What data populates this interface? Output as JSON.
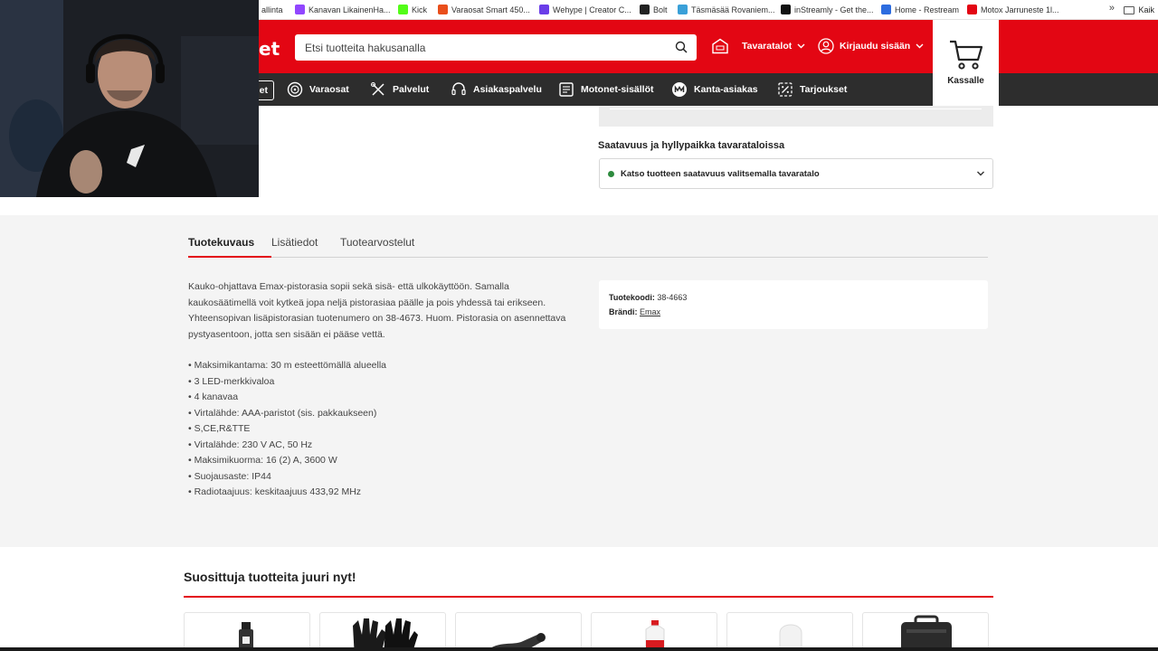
{
  "bookmarks": [
    {
      "label": "allinta",
      "color": "#777777"
    },
    {
      "label": "Kanavan LikainenHa...",
      "color": "#9146ff"
    },
    {
      "label": "Kick",
      "color": "#53fc18"
    },
    {
      "label": "Varaosat Smart 450...",
      "color": "#e94e1b"
    },
    {
      "label": "Wehype | Creator C...",
      "color": "#6a3de8"
    },
    {
      "label": "Bolt",
      "color": "#222222"
    },
    {
      "label": "Täsmäsää Rovaniem...",
      "color": "#3aa0d8"
    },
    {
      "label": "inStreamly - Get the...",
      "color": "#111111"
    },
    {
      "label": "Home - Restream",
      "color": "#2d6cdf"
    },
    {
      "label": "Motox Jarruneste 1l...",
      "color": "#e30613"
    }
  ],
  "bookmarks_more": "»",
  "bookmarks_folder": "Kaik",
  "header": {
    "logo_fragment": "et",
    "search_placeholder": "Etsi tuotteita hakusanalla",
    "stores_label": "Tavaratalot",
    "login_label": "Kirjaudu sisään",
    "cart_label": "Kassalle"
  },
  "nav": {
    "outlined_fragment": "et",
    "items": [
      "Varaosat",
      "Palvelut",
      "Asiakaspalvelu",
      "Motonet-sisällöt",
      "Kanta-asiakas",
      "Tarjoukset"
    ]
  },
  "availability": {
    "title": "Saatavuus ja hyllypaikka tavarataloissa",
    "prompt": "Katso tuotteen saatavuus valitsemalla tavaratalo",
    "status_color": "#2e8b3e"
  },
  "tabs": [
    "Tuotekuvaus",
    "Lisätiedot",
    "Tuotearvostelut"
  ],
  "description": {
    "paragraph": "Kauko-ohjattava Emax-pistorasia sopii sekä sisä- että ulkokäyttöön. Samalla kaukosäätimellä voit kytkeä jopa neljä pistorasiaa päälle ja pois yhdessä tai erikseen. Yhteensopivan lisäpistorasian tuotenumero on 38-4673. Huom. Pistorasia on asennettava pystyasentoon, jotta sen sisään ei pääse vettä.",
    "bullets": [
      "• Maksimikantama: 30 m esteettömällä alueella",
      "• 3 LED-merkkivaloa",
      "• 4 kanavaa",
      "• Virtalähde: AAA-paristot (sis. pakkaukseen)",
      "• S,CE,R&TTE",
      "• Virtalähde: 230 V AC, 50 Hz",
      "• Maksimikuorma: 16 (2) A, 3600 W",
      "• Suojausaste: IP44",
      "• Radiotaajuus: keskitaajuus 433,92 MHz"
    ]
  },
  "product_info": {
    "code_label": "Tuotekoodi:",
    "code_value": "38-4663",
    "brand_label": "Brändi:",
    "brand_value": "Emax"
  },
  "recommended": {
    "title": "Suosittuja tuotteita juuri nyt!"
  },
  "colors": {
    "brand_red": "#e30613",
    "nav_dark": "#2d2d2d",
    "section_grey": "#f4f4f4"
  }
}
